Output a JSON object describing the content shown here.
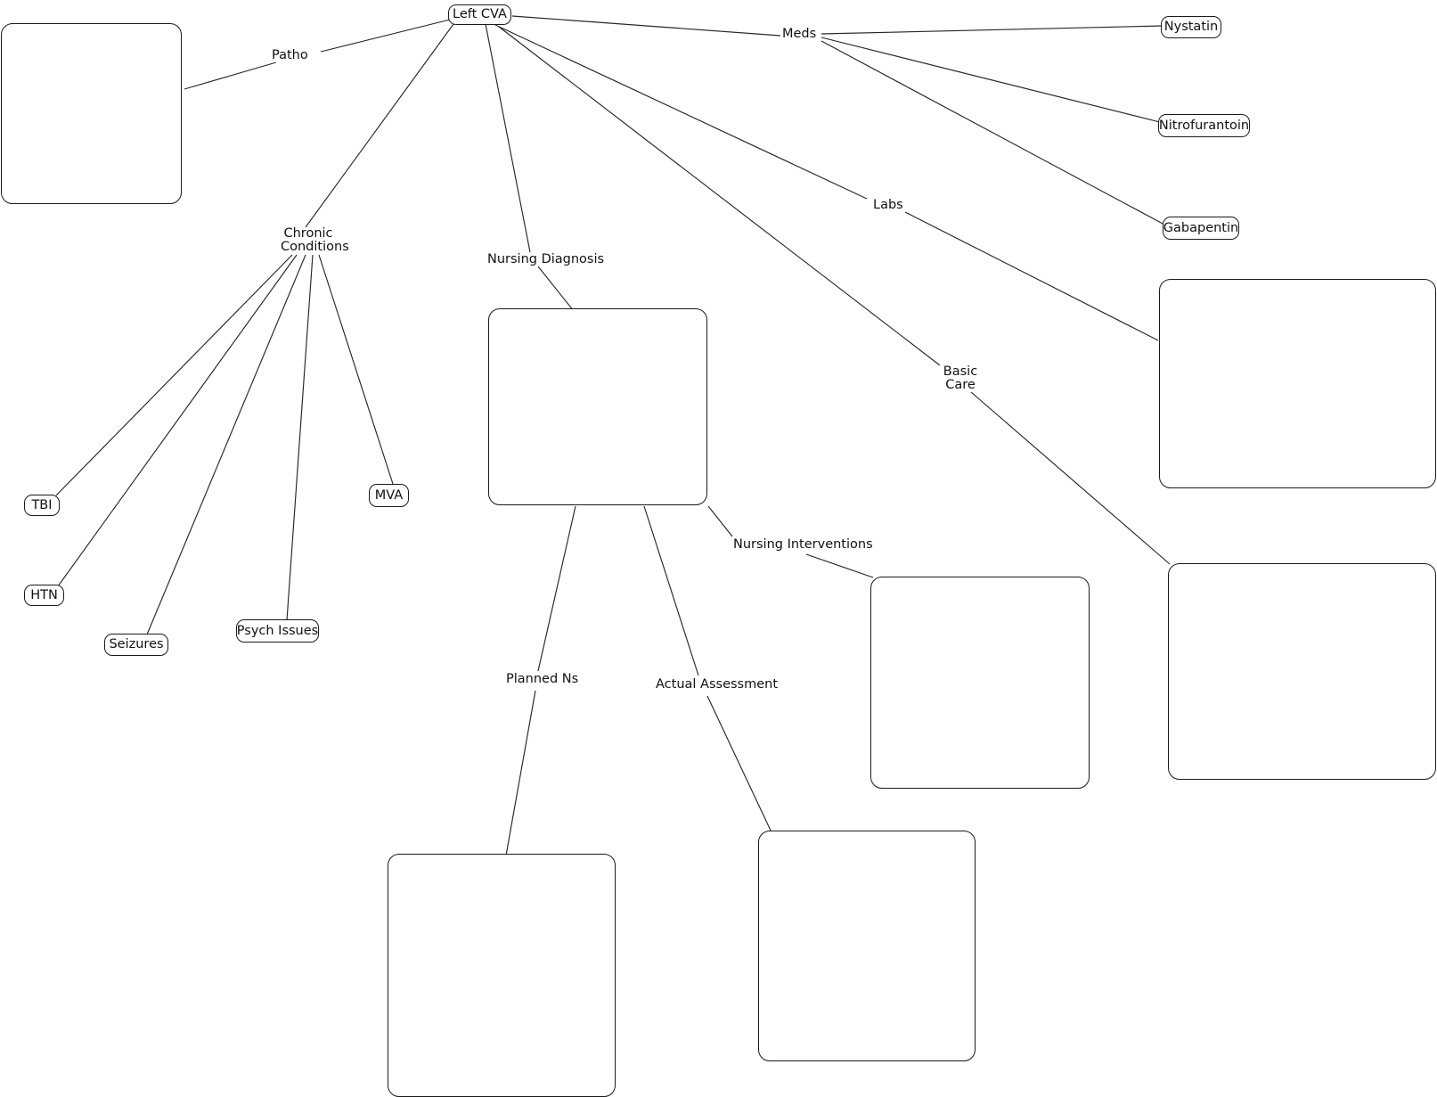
{
  "map": {
    "title": "Left CVA",
    "background_color": "#ffffff",
    "line_color": "#262626",
    "node_border_color": "#1a1a1a",
    "text_color": "#111111"
  },
  "root": {
    "label": "Left CVA"
  },
  "branch_labels": {
    "patho": "Patho",
    "chronic_conditions": "Chronic\nConditions",
    "nursing_diagnosis": "Nursing Diagnosis",
    "labs": "Labs",
    "basic_care": "Basic\nCare",
    "meds": "Meds",
    "nursing_interventions": "Nursing Interventions",
    "planned_ns": "Planned Ns",
    "actual_assessment": "Actual Assessment"
  },
  "chronic_condition_nodes": [
    {
      "label": "TBI"
    },
    {
      "label": "HTN"
    },
    {
      "label": "Seizures"
    },
    {
      "label": "Psych Issues"
    },
    {
      "label": "MVA"
    }
  ],
  "medication_nodes": [
    {
      "label": "Nystatin"
    },
    {
      "label": "Nitrofurantoin"
    },
    {
      "label": "Gabapentin"
    }
  ],
  "empty_boxes": [
    {
      "name": "patho-detail-box",
      "content": ""
    },
    {
      "name": "nursing-diagnosis-box",
      "content": ""
    },
    {
      "name": "labs-detail-box",
      "content": ""
    },
    {
      "name": "nursing-interventions-box",
      "content": ""
    },
    {
      "name": "basic-care-box",
      "content": ""
    },
    {
      "name": "planned-ns-box",
      "content": ""
    },
    {
      "name": "actual-assessment-box",
      "content": ""
    }
  ]
}
